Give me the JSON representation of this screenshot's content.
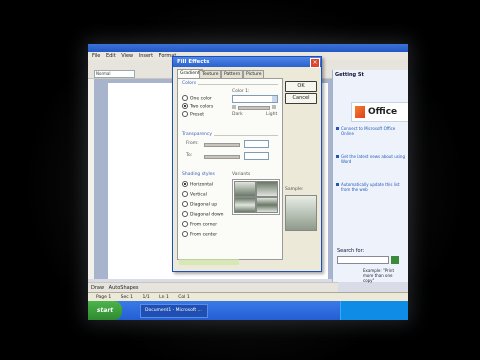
{
  "app": {
    "menu": [
      "File",
      "Edit",
      "View",
      "Insert",
      "Format"
    ],
    "style_box": "Normal"
  },
  "dialog": {
    "title": "Fill Effects",
    "tabs": [
      "Gradient",
      "Texture",
      "Pattern",
      "Picture"
    ],
    "colors_group": "Colors",
    "color_label": "Color 1:",
    "color_options": [
      "One color",
      "Two colors",
      "Preset"
    ],
    "dark_label": "Dark",
    "light_label": "Light",
    "transparency_group": "Transparency",
    "from_label": "From:",
    "to_label": "To:",
    "shading_group": "Shading styles",
    "shading_options": [
      "Horizontal",
      "Vertical",
      "Diagonal up",
      "Diagonal down",
      "From corner",
      "From center"
    ],
    "variants_label": "Variants",
    "sample_label": "Sample:",
    "ok": "OK",
    "cancel": "Cancel"
  },
  "taskpane": {
    "title": "Getting St",
    "logo_text": "Office",
    "links": [
      "Connect to Microsoft Office Online",
      "Get the latest news about using Word",
      "Automatically update this list from the web"
    ],
    "search_label": "Search for:",
    "example": "Example: \"Print more than one copy\""
  },
  "drawbar": {
    "draw": "Draw",
    "autoshapes": "AutoShapes"
  },
  "status": {
    "page": "Page 1",
    "sec": "Sec 1",
    "pages": "1/1",
    "ln": "Ln 1",
    "col": "Col 1"
  },
  "taskbar": {
    "start": "start",
    "doc": "Document1 - Microsoft ..."
  }
}
